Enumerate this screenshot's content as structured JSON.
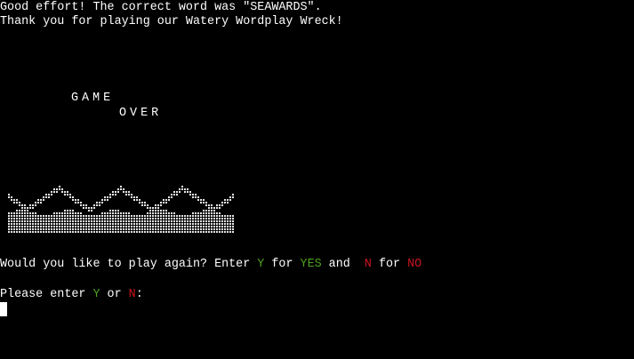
{
  "terminal": {
    "line1": "Good effort! The correct word was \"SEAWARDS\".",
    "line2": "Thank you for playing our Watery Wordplay Wreck!",
    "game_word": "GAME",
    "over_word": "OVER",
    "prompt": {
      "part1": "Would you like to play again? Enter ",
      "y": "Y",
      "part2": " for ",
      "yes": "YES",
      "part3": " and  ",
      "n": "N",
      "part4": " for ",
      "no": "NO"
    },
    "enter": {
      "part1": "Please enter ",
      "y": "Y",
      "part2": " or ",
      "n": "N",
      "part3": ":"
    }
  },
  "colors": {
    "background": "#000000",
    "text": "#ffffff",
    "yes_green": "#4ea11e",
    "no_red": "#c8161d"
  },
  "icons": {
    "waves": "dotted-waves-art"
  }
}
